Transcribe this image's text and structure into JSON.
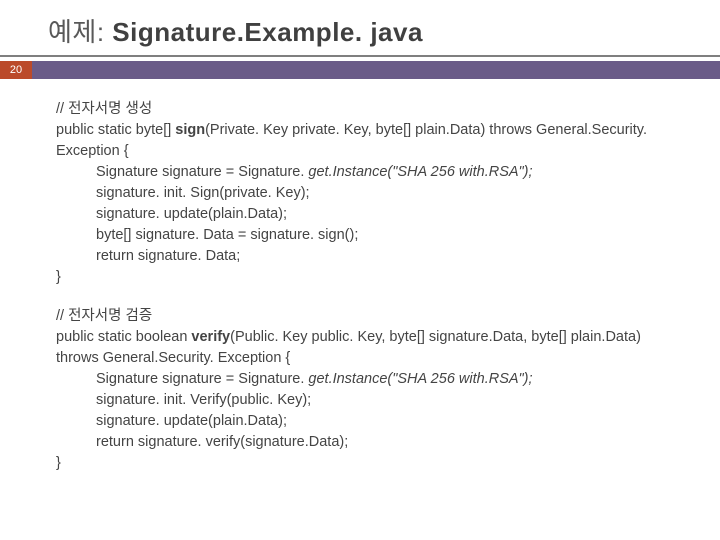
{
  "title": {
    "prefix": "예제: ",
    "main": "Signature.Example. java"
  },
  "pageNumber": "20",
  "code": {
    "block1": {
      "comment": "// 전자서명 생성",
      "sig_a": "public static byte[] ",
      "sig_b": "sign",
      "sig_c": "(Private. Key private. Key, byte[] plain.Data) throws General.Security. Exception {",
      "line1a": "Signature signature = Signature. ",
      "line1b": "get.Instance(\"SHA 256 with.RSA\");",
      "line2": "signature. init. Sign(private. Key);",
      "line3": "signature. update(plain.Data);",
      "line4": "byte[] signature. Data = signature. sign();",
      "line5": "return signature. Data;",
      "close": "}"
    },
    "block2": {
      "comment": "// 전자서명 검증",
      "sig_a": "public static boolean ",
      "sig_b": "verify",
      "sig_c": "(Public. Key public. Key, byte[] signature.Data, byte[] plain.Data) throws General.Security. Exception {",
      "line1a": "Signature signature = Signature. ",
      "line1b": "get.Instance(\"SHA 256 with.RSA\");",
      "line2": "signature. init. Verify(public. Key);",
      "line3": "signature. update(plain.Data);",
      "line4": "return signature. verify(signature.Data);",
      "close": "}"
    }
  }
}
